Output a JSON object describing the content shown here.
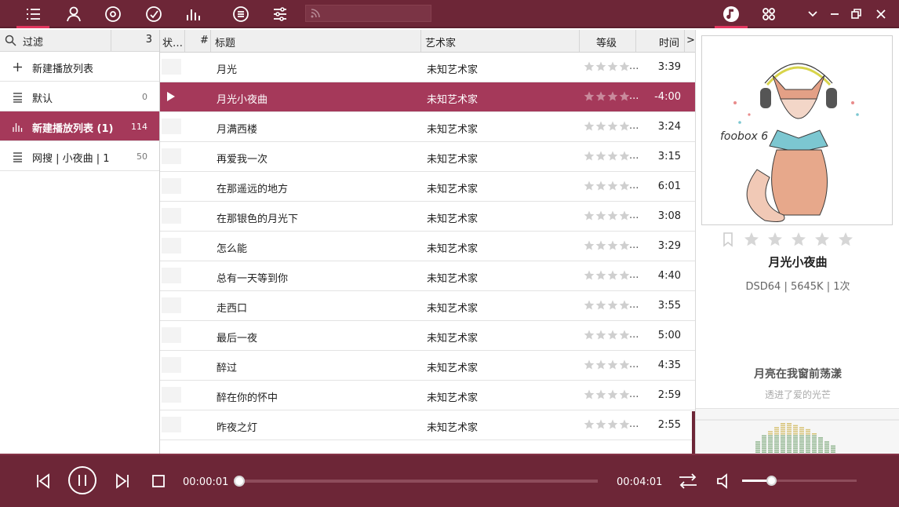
{
  "toolbar": {
    "left_icons": [
      "playlist-icon",
      "artist-icon",
      "album-icon",
      "genre-icon",
      "equalizer-bars-icon",
      "menu-icon",
      "settings-sliders-icon"
    ],
    "search_placeholder": "",
    "right_icons": [
      "music-note-icon",
      "grid-icon",
      "minimize-chevron-icon",
      "minimize-icon",
      "restore-icon",
      "close-icon"
    ]
  },
  "sidebar": {
    "filter_label": "过滤",
    "filter_count": "3",
    "items": [
      {
        "label": "新建播放列表",
        "count": "",
        "icon": "plus-icon"
      },
      {
        "label": "默认",
        "count": "0",
        "icon": "list-icon"
      },
      {
        "label": "新建播放列表 (1)",
        "count": "114",
        "icon": "bars-icon",
        "selected": true
      },
      {
        "label": "网搜 | 小夜曲 | 1",
        "count": "50",
        "icon": "list-icon"
      }
    ]
  },
  "columns": {
    "status": "状…",
    "number": "#",
    "title": "标题",
    "artist": "艺术家",
    "rating": "等级",
    "time": "时间",
    "more": ">"
  },
  "tracks": [
    {
      "title": "月光",
      "artist": "未知艺术家",
      "rating_more": "...",
      "duration": "3:39"
    },
    {
      "title": "月光小夜曲",
      "artist": "未知艺术家",
      "rating_more": "...",
      "duration": "-4:00",
      "playing": true
    },
    {
      "title": "月满西楼",
      "artist": "未知艺术家",
      "rating_more": "...",
      "duration": "3:24"
    },
    {
      "title": "再爱我一次",
      "artist": "未知艺术家",
      "rating_more": "...",
      "duration": "3:15"
    },
    {
      "title": "在那遥远的地方",
      "artist": "未知艺术家",
      "rating_more": "...",
      "duration": "6:01"
    },
    {
      "title": "在那银色的月光下",
      "artist": "未知艺术家",
      "rating_more": "...",
      "duration": "3:08"
    },
    {
      "title": "怎么能",
      "artist": "未知艺术家",
      "rating_more": "...",
      "duration": "3:29"
    },
    {
      "title": "总有一天等到你",
      "artist": "未知艺术家",
      "rating_more": "...",
      "duration": "4:40"
    },
    {
      "title": "走西口",
      "artist": "未知艺术家",
      "rating_more": "...",
      "duration": "3:55"
    },
    {
      "title": "最后一夜",
      "artist": "未知艺术家",
      "rating_more": "...",
      "duration": "5:00"
    },
    {
      "title": "醉过",
      "artist": "未知艺术家",
      "rating_more": "...",
      "duration": "4:35"
    },
    {
      "title": "醉在你的怀中",
      "artist": "未知艺术家",
      "rating_more": "...",
      "duration": "2:59"
    },
    {
      "title": "昨夜之灯",
      "artist": "未知艺术家",
      "rating_more": "...",
      "duration": "2:55"
    }
  ],
  "now_playing": {
    "cover_text": "foobox 6",
    "title": "月光小夜曲",
    "info": "DSD64 | 5645K | 1次",
    "lyric_current": "月亮在我窗前荡漾",
    "lyric_next": "透进了爱的光芒"
  },
  "playback": {
    "elapsed": "00:00:01",
    "total": "00:04:01",
    "progress": 0.004,
    "volume": 0.25
  },
  "colors": {
    "accent": "#6d2637",
    "highlight": "#a5395a",
    "tab_underline": "#e2365f"
  }
}
